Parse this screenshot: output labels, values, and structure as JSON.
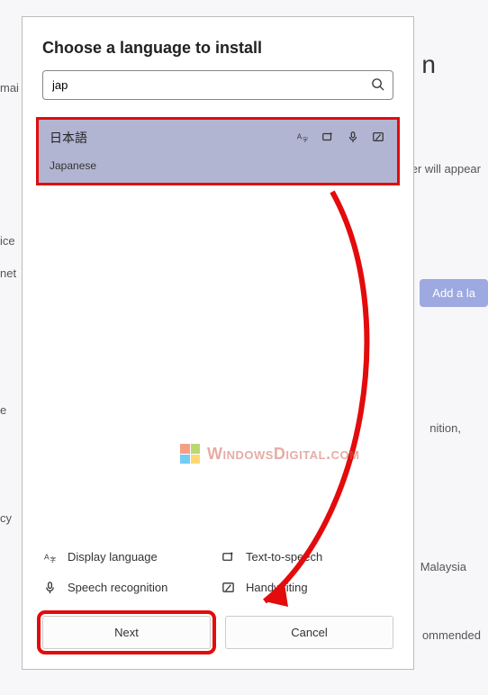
{
  "dialog": {
    "title": "Choose a language to install",
    "search_value": "jap",
    "result": {
      "native": "日本語",
      "name": "Japanese"
    },
    "legend": {
      "display_language": "Display language",
      "text_to_speech": "Text-to-speech",
      "speech_recognition": "Speech recognition",
      "handwriting": "Handwriting"
    },
    "next": "Next",
    "cancel": "Cancel"
  },
  "background": {
    "mai": "mai",
    "ice": "ice",
    "net": "net",
    "cy": "cy",
    "e": "e",
    "rer_appear": "rer will appear",
    "nition": "nition,",
    "malaysia": "Malaysia",
    "recommended": "ommended",
    "add_lang": "Add a la",
    "n": "n"
  },
  "watermark": "WindowsDigital.com"
}
